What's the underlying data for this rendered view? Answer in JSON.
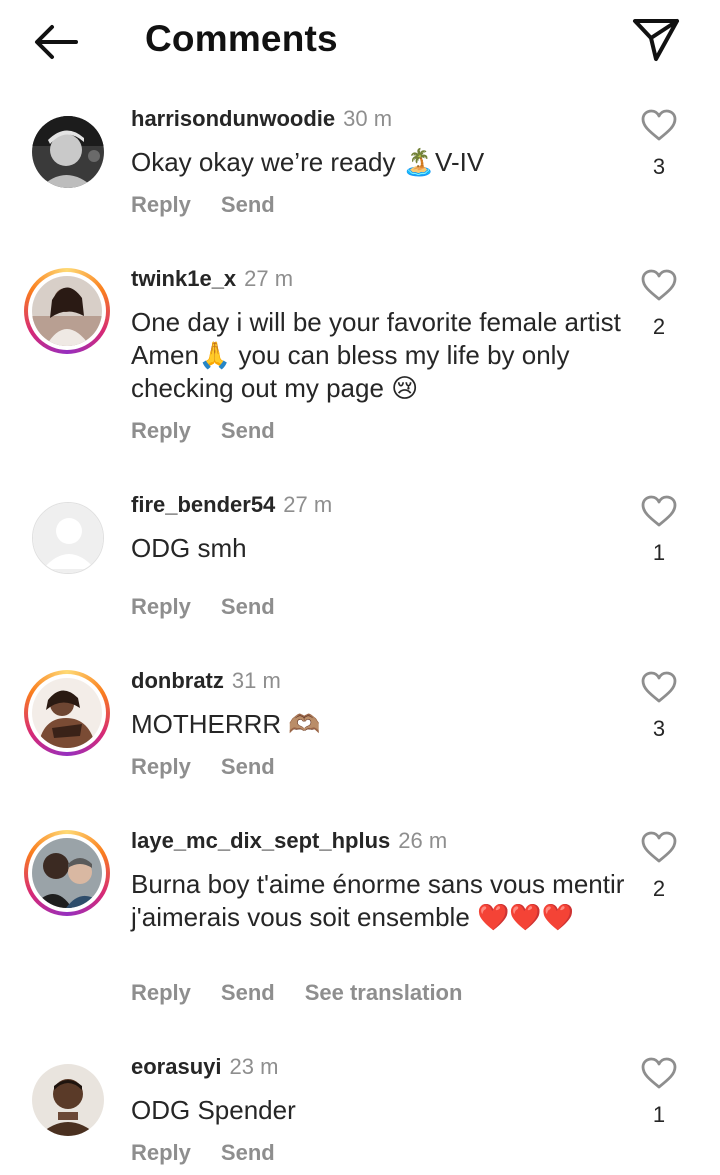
{
  "header": {
    "title": "Comments",
    "back_icon": "arrow-left-icon",
    "send_icon": "paper-plane-icon"
  },
  "actions": {
    "reply": "Reply",
    "send": "Send",
    "see_translation": "See translation"
  },
  "colors": {
    "text": "#262626",
    "muted": "#8e8e8e",
    "ring_start": "#feda75",
    "ring_end": "#962fbf"
  },
  "comments": [
    {
      "username": "harrisondunwoodie",
      "time": "30 m",
      "text": "Okay okay we’re ready 🏝️V-IV",
      "likes": "3",
      "story_ring": false
    },
    {
      "username": "twink1e_x",
      "time": "27 m",
      "text": "One day i will be your favorite female artist Amen🙏 you can bless my life by only checking out my page 😢",
      "likes": "2",
      "story_ring": true
    },
    {
      "username": "fire_bender54",
      "time": "27 m",
      "text": "ODG smh",
      "likes": "1",
      "story_ring": false
    },
    {
      "username": "donbratz",
      "time": "31 m",
      "text": "MOTHERRR 🫶🏽",
      "likes": "3",
      "story_ring": true
    },
    {
      "username": "laye_mc_dix_sept_hplus",
      "time": "26 m",
      "text": "Burna boy t'aime énorme sans vous mentir j'aimerais vous soit ensemble ❤️❤️❤️",
      "likes": "2",
      "story_ring": true
    },
    {
      "username": "eorasuyi",
      "time": "23 m",
      "text": "ODG Spender",
      "likes": "1",
      "story_ring": false
    }
  ]
}
